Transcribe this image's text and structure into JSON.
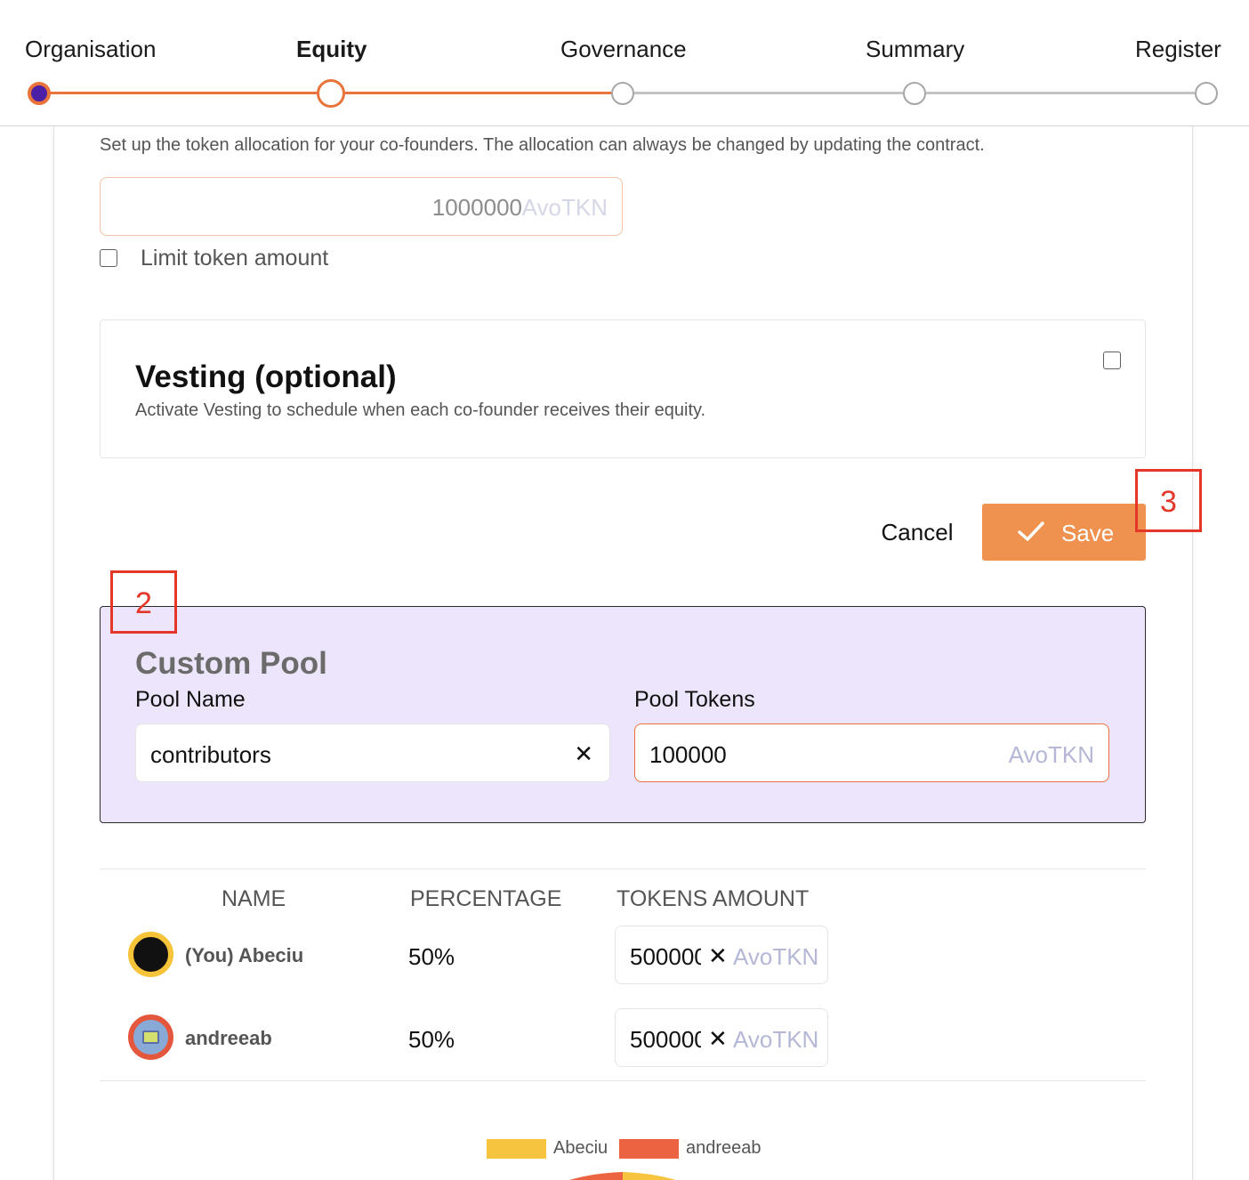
{
  "stepper": {
    "steps": [
      {
        "label": "Organisation",
        "state": "done"
      },
      {
        "label": "Equity",
        "state": "current"
      },
      {
        "label": "Governance",
        "state": "todo"
      },
      {
        "label": "Summary",
        "state": "todo"
      },
      {
        "label": "Register",
        "state": "todo"
      }
    ]
  },
  "supply": {
    "description": "Set up the token allocation for your co-founders. The allocation can always be changed by updating the contract.",
    "value": "1000000",
    "unit": "AvoTKN",
    "limit_label": "Limit token amount"
  },
  "vesting": {
    "title": "Vesting (optional)",
    "description": "Activate Vesting to schedule when each co-founder receives their equity."
  },
  "actions": {
    "cancel_label": "Cancel",
    "save_label": "Save"
  },
  "markers": {
    "save": "3",
    "pool": "2"
  },
  "pool": {
    "title": "Custom Pool",
    "name_label": "Pool Name",
    "name_value": "contributors",
    "tokens_label": "Pool Tokens",
    "tokens_value": "100000",
    "tokens_unit": "AvoTKN"
  },
  "table": {
    "headers": {
      "name": "NAME",
      "percentage": "PERCENTAGE",
      "tokens": "TOKENS AMOUNT"
    },
    "rows": [
      {
        "name": "(You) Abeciu",
        "percentage": "50%",
        "tokens": "500000",
        "unit": "AvoTKN"
      },
      {
        "name": "andreeab",
        "percentage": "50%",
        "tokens": "500000",
        "unit": "AvoTKN"
      }
    ]
  },
  "legend": {
    "items": [
      {
        "label": "Abeciu",
        "color": "#f6c43f"
      },
      {
        "label": "andreeab",
        "color": "#eb6340"
      }
    ]
  },
  "colors": {
    "accent": "#e8743b",
    "save_button": "#ef9250",
    "pool_background": "#ece5fb",
    "marker": "#e4372a",
    "step_done_fill": "#4b1fa6"
  }
}
